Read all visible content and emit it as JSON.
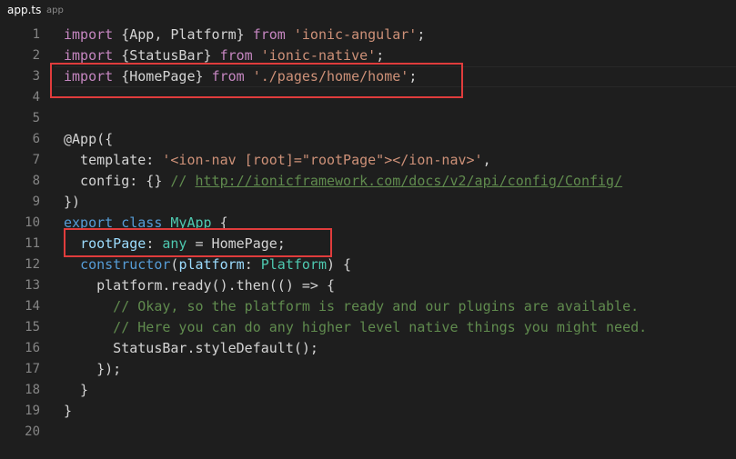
{
  "tab": {
    "filename": "app.ts",
    "folder": "app"
  },
  "colors": {
    "background": "#1e1e1e",
    "keyword": "#c586c0",
    "keyword_blue": "#569cd6",
    "string": "#ce9178",
    "comment": "#608b4e",
    "type": "#4ec9b0",
    "property": "#9cdcfe",
    "text": "#d4d4d4",
    "highlight_box": "#e03c3c"
  },
  "highlight_boxes": [
    {
      "label": "highlight-line-3",
      "covers_lines": [
        3
      ]
    },
    {
      "label": "highlight-line-11",
      "covers_lines": [
        11
      ]
    }
  ],
  "lines": [
    {
      "num": "1",
      "tokens": [
        {
          "t": "import",
          "c": "kw"
        },
        {
          "t": " {App, Platform} ",
          "c": "plain"
        },
        {
          "t": "from",
          "c": "kw"
        },
        {
          "t": " ",
          "c": "plain"
        },
        {
          "t": "'ionic-angular'",
          "c": "str"
        },
        {
          "t": ";",
          "c": "plain"
        }
      ]
    },
    {
      "num": "2",
      "tokens": [
        {
          "t": "import",
          "c": "kw"
        },
        {
          "t": " {StatusBar} ",
          "c": "plain"
        },
        {
          "t": "from",
          "c": "kw"
        },
        {
          "t": " ",
          "c": "plain"
        },
        {
          "t": "'ionic-native'",
          "c": "str"
        },
        {
          "t": ";",
          "c": "plain"
        }
      ]
    },
    {
      "num": "3",
      "current": true,
      "tokens": [
        {
          "t": "import",
          "c": "kw"
        },
        {
          "t": " {HomePage} ",
          "c": "plain"
        },
        {
          "t": "from",
          "c": "kw"
        },
        {
          "t": " ",
          "c": "plain"
        },
        {
          "t": "'./pages/home/home'",
          "c": "str"
        },
        {
          "t": ";",
          "c": "plain"
        }
      ]
    },
    {
      "num": "4",
      "tokens": []
    },
    {
      "num": "5",
      "tokens": []
    },
    {
      "num": "6",
      "tokens": [
        {
          "t": "@App({",
          "c": "plain"
        }
      ]
    },
    {
      "num": "7",
      "tokens": [
        {
          "t": "  template: ",
          "c": "plain"
        },
        {
          "t": "'<ion-nav [root]=\"rootPage\"></ion-nav>'",
          "c": "str"
        },
        {
          "t": ",",
          "c": "plain"
        }
      ]
    },
    {
      "num": "8",
      "tokens": [
        {
          "t": "  config: {} ",
          "c": "plain"
        },
        {
          "t": "// ",
          "c": "cmt"
        },
        {
          "t": "http://ionicframework.com/docs/v2/api/config/Config/",
          "c": "url"
        }
      ]
    },
    {
      "num": "9",
      "tokens": [
        {
          "t": "})",
          "c": "plain"
        }
      ]
    },
    {
      "num": "10",
      "tokens": [
        {
          "t": "export",
          "c": "kwb"
        },
        {
          "t": " ",
          "c": "plain"
        },
        {
          "t": "class",
          "c": "kwb"
        },
        {
          "t": " ",
          "c": "plain"
        },
        {
          "t": "MyApp",
          "c": "typ"
        },
        {
          "t": " {",
          "c": "plain"
        }
      ]
    },
    {
      "num": "11",
      "tokens": [
        {
          "t": "  ",
          "c": "plain"
        },
        {
          "t": "rootPage",
          "c": "prop"
        },
        {
          "t": ": ",
          "c": "plain"
        },
        {
          "t": "any",
          "c": "typ"
        },
        {
          "t": " = HomePage;",
          "c": "plain"
        }
      ]
    },
    {
      "num": "12",
      "tokens": [
        {
          "t": "  ",
          "c": "plain"
        },
        {
          "t": "constructor",
          "c": "kwb"
        },
        {
          "t": "(",
          "c": "plain"
        },
        {
          "t": "platform",
          "c": "prop"
        },
        {
          "t": ": ",
          "c": "plain"
        },
        {
          "t": "Platform",
          "c": "typ"
        },
        {
          "t": ") {",
          "c": "plain"
        }
      ]
    },
    {
      "num": "13",
      "tokens": [
        {
          "t": "    platform.ready().then(() => {",
          "c": "plain"
        }
      ]
    },
    {
      "num": "14",
      "tokens": [
        {
          "t": "      // Okay, so the platform is ready and our plugins are available.",
          "c": "cmt"
        }
      ]
    },
    {
      "num": "15",
      "tokens": [
        {
          "t": "      // Here you can do any higher level native things you might need.",
          "c": "cmt"
        }
      ]
    },
    {
      "num": "16",
      "tokens": [
        {
          "t": "      StatusBar.styleDefault();",
          "c": "plain"
        }
      ]
    },
    {
      "num": "17",
      "tokens": [
        {
          "t": "    });",
          "c": "plain"
        }
      ]
    },
    {
      "num": "18",
      "tokens": [
        {
          "t": "  }",
          "c": "plain"
        }
      ]
    },
    {
      "num": "19",
      "tokens": [
        {
          "t": "}",
          "c": "plain"
        }
      ]
    },
    {
      "num": "20",
      "tokens": []
    }
  ]
}
